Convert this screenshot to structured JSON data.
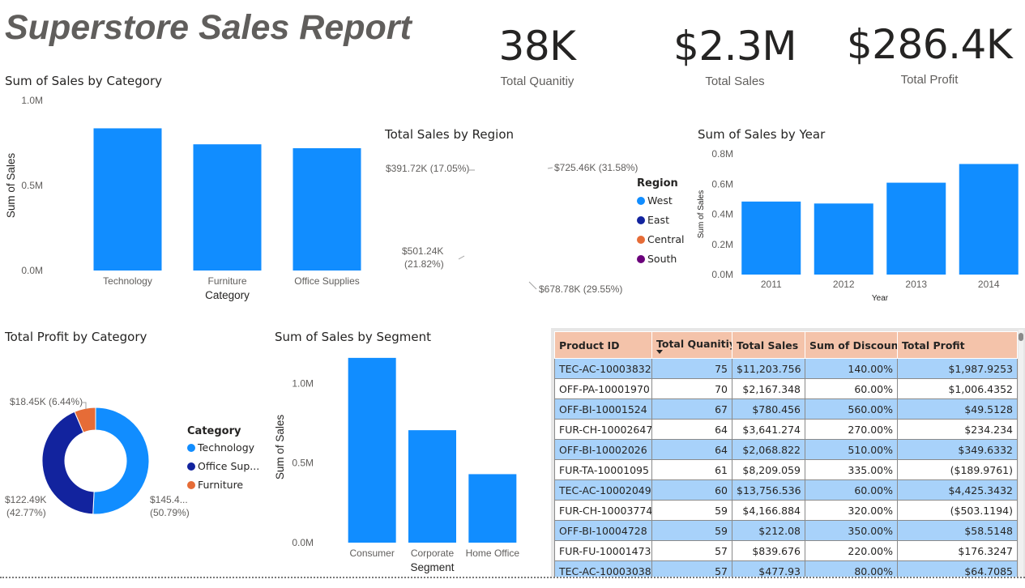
{
  "report_title": "Superstore Sales Report",
  "kpis": [
    {
      "value": "38K",
      "label": "Total Quanitiy"
    },
    {
      "value": "$2.3M",
      "label": "Total Sales"
    },
    {
      "value": "$286.4K",
      "label": "Total Profit"
    }
  ],
  "colors": {
    "primary": "#118dff",
    "navy": "#12239e",
    "orange": "#e66c37",
    "purple": "#6b007b",
    "header_bg": "#f4c3aa",
    "row_band": "#a8d2fa"
  },
  "chart_data": [
    {
      "id": "sales_by_category",
      "type": "bar",
      "title": "Sum of Sales by Category",
      "xlabel": "Category",
      "ylabel": "Sum of Sales",
      "categories": [
        "Technology",
        "Furniture",
        "Office Supplies"
      ],
      "values": [
        836000,
        742000,
        719000
      ],
      "ylim": [
        0,
        1000000
      ],
      "yticks": [
        "0.0M",
        "0.5M",
        "1.0M"
      ],
      "ytick_values": [
        0,
        500000,
        1000000
      ],
      "grid": false
    },
    {
      "id": "sales_by_region",
      "type": "pie",
      "title": "Total Sales by Region",
      "legend_title": "Region",
      "legend_position": "right",
      "slices": [
        {
          "name": "West",
          "value": 725460,
          "label": "$725.46K (31.58%)",
          "color": "#118dff"
        },
        {
          "name": "East",
          "value": 678780,
          "label": "$678.78K (29.55%)",
          "color": "#12239e"
        },
        {
          "name": "Central",
          "value": 501240,
          "label": "$501.24K (21.82%)",
          "label_line1": "$501.24K",
          "label_line2": "(21.82%)",
          "color": "#e66c37"
        },
        {
          "name": "South",
          "value": 391720,
          "label": "$391.72K (17.05%)",
          "color": "#6b007b"
        }
      ]
    },
    {
      "id": "sales_by_year",
      "type": "bar",
      "title": "Sum of Sales by Year",
      "xlabel": "Year",
      "ylabel": "Sum of Sales",
      "categories": [
        "2011",
        "2012",
        "2013",
        "2014"
      ],
      "values": [
        484000,
        471000,
        609000,
        733000
      ],
      "ylim": [
        0,
        800000
      ],
      "yticks": [
        "0.0M",
        "0.2M",
        "0.4M",
        "0.6M",
        "0.8M"
      ],
      "ytick_values": [
        0,
        200000,
        400000,
        600000,
        800000
      ],
      "grid": false
    },
    {
      "id": "profit_by_category",
      "type": "pie",
      "subtype": "donut",
      "title": "Total Profit by Category",
      "legend_title": "Category",
      "legend_position": "right",
      "slices": [
        {
          "name": "Technology",
          "value": 145450,
          "label_line1": "$145.4...",
          "label_line2": "(50.79%)",
          "color": "#118dff"
        },
        {
          "name": "Office Sup...",
          "value": 122490,
          "label_line1": "$122.49K",
          "label_line2": "(42.77%)",
          "color": "#12239e"
        },
        {
          "name": "Furniture",
          "value": 18450,
          "label": "$18.45K (6.44%)",
          "color": "#e66c37"
        }
      ]
    },
    {
      "id": "sales_by_segment",
      "type": "bar",
      "title": "Sum of Sales by Segment",
      "xlabel": "Segment",
      "ylabel": "Sum of Sales",
      "categories": [
        "Consumer",
        "Corporate",
        "Home Office"
      ],
      "values": [
        1160000,
        706000,
        430000
      ],
      "ylim": [
        0,
        1200000
      ],
      "yticks": [
        "0.0M",
        "0.5M",
        "1.0M"
      ],
      "ytick_values": [
        0,
        500000,
        1000000
      ],
      "grid": false
    }
  ],
  "table": {
    "columns": [
      "Product ID",
      "Total Quanitiy",
      "Total Sales",
      "Sum of Discount",
      "Total Profit"
    ],
    "sorted_column": "Total Quanitiy",
    "rows": [
      [
        "TEC-AC-10003832",
        "75",
        "$11,203.756",
        "140.00%",
        "$1,987.9253"
      ],
      [
        "OFF-PA-10001970",
        "70",
        "$2,167.348",
        "60.00%",
        "$1,006.4352"
      ],
      [
        "OFF-BI-10001524",
        "67",
        "$780.456",
        "560.00%",
        "$49.5128"
      ],
      [
        "FUR-CH-10002647",
        "64",
        "$3,641.274",
        "270.00%",
        "$234.234"
      ],
      [
        "OFF-BI-10002026",
        "64",
        "$2,068.822",
        "510.00%",
        "$349.6332"
      ],
      [
        "FUR-TA-10001095",
        "61",
        "$8,209.059",
        "335.00%",
        "($189.9761)"
      ],
      [
        "TEC-AC-10002049",
        "60",
        "$13,756.536",
        "60.00%",
        "$4,425.3432"
      ],
      [
        "FUR-CH-10003774",
        "59",
        "$4,166.884",
        "320.00%",
        "($503.1194)"
      ],
      [
        "OFF-BI-10004728",
        "59",
        "$212.08",
        "350.00%",
        "$58.5148"
      ],
      [
        "FUR-FU-10001473",
        "57",
        "$839.676",
        "220.00%",
        "$176.3247"
      ],
      [
        "TEC-AC-10003038",
        "57",
        "$477.93",
        "80.00%",
        "$64.7085"
      ]
    ]
  }
}
